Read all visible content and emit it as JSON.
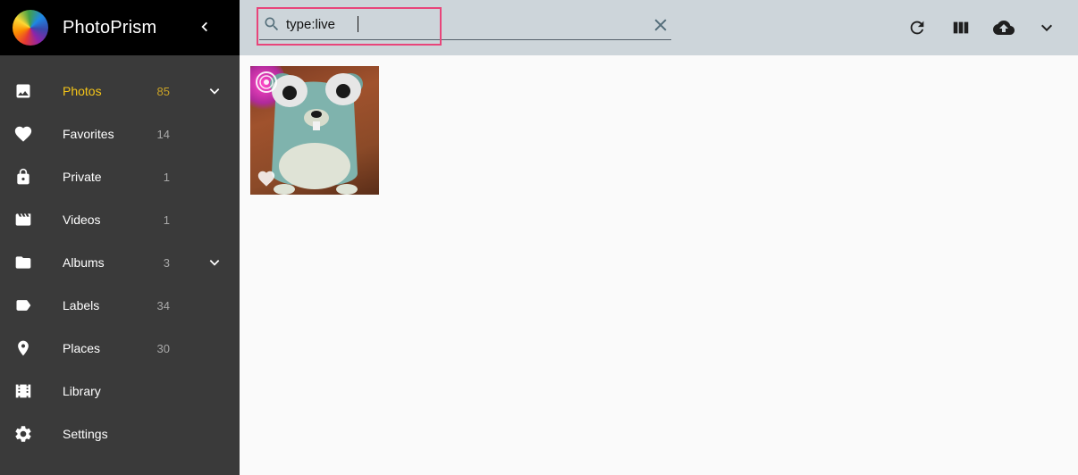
{
  "app": {
    "name": "PhotoPrism"
  },
  "sidebar": {
    "items": [
      {
        "label": "Photos",
        "count": "85",
        "icon": "photo-icon",
        "active": true,
        "expandable": true
      },
      {
        "label": "Favorites",
        "count": "14",
        "icon": "heart-icon"
      },
      {
        "label": "Private",
        "count": "1",
        "icon": "lock-icon"
      },
      {
        "label": "Videos",
        "count": "1",
        "icon": "movie-icon"
      },
      {
        "label": "Albums",
        "count": "3",
        "icon": "folder-icon",
        "expandable": true
      },
      {
        "label": "Labels",
        "count": "34",
        "icon": "label-icon"
      },
      {
        "label": "Places",
        "count": "30",
        "icon": "place-icon"
      },
      {
        "label": "Library",
        "count": "",
        "icon": "library-icon"
      },
      {
        "label": "Settings",
        "count": "",
        "icon": "settings-icon"
      }
    ]
  },
  "search": {
    "value": "type:live"
  },
  "toolbar": {
    "buttons": [
      "refresh-icon",
      "view-column-icon",
      "cloud-upload-icon",
      "chevron-down-icon"
    ]
  },
  "colors": {
    "sidebar_bg": "#3a3a3a",
    "toolbar_bg": "#cdd5da",
    "active_accent": "#f5c518",
    "highlight": "#e8457a"
  }
}
